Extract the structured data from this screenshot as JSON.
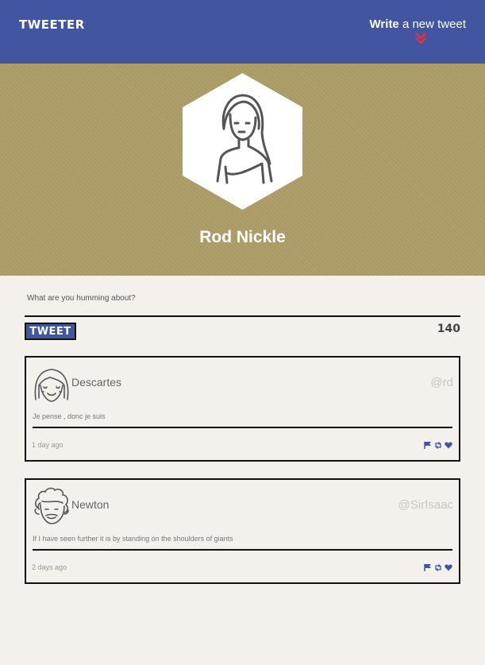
{
  "nav": {
    "brand": "TWEETER",
    "compose_bold": "Write",
    "compose_rest": " a new tweet",
    "chevron_icon": "double-chevron-down-icon"
  },
  "profile": {
    "name": "Rod Nickle",
    "avatar_icon": "woman-avatar-icon"
  },
  "composer": {
    "prompt": "What are you humming about?",
    "button_label": "TWEET",
    "char_count": "140"
  },
  "tweets": [
    {
      "name": "Descartes",
      "handle": "@rd",
      "text": "Je pense , donc je suis",
      "time": "1 day ago",
      "avatar_icon": "girl-avatar-icon"
    },
    {
      "name": "Newton",
      "handle": "@SirIsaac",
      "text": "If I have seen further it is by standing on the shoulders of giants",
      "time": "2 days ago",
      "avatar_icon": "curly-hair-man-avatar-icon"
    }
  ],
  "colors": {
    "nav_bg": "#4155a0",
    "hero_bg": "#ad9d68",
    "page_bg": "#f4f1ec",
    "accent_red": "#e8323c",
    "icon_blue": "#4155a0"
  }
}
